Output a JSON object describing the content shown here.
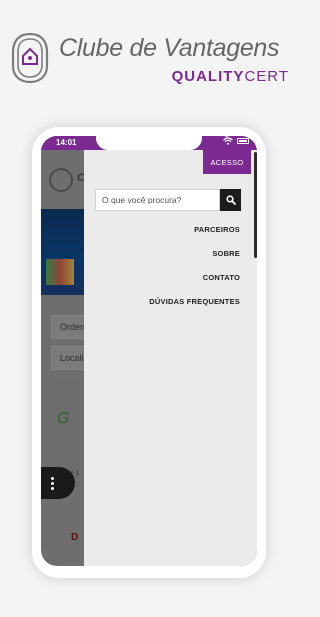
{
  "brand": {
    "title": "Clube de Vantagens",
    "subtitle_part1": "QUALITY",
    "subtitle_part2": "CERT"
  },
  "status_bar": {
    "time": "14:01",
    "icons": [
      "wifi-icon",
      "battery-icon"
    ]
  },
  "background_page": {
    "logo_text": "C",
    "order_field": "Orden",
    "location_field": "Locali",
    "small_text": "Até 1",
    "red_text": "D"
  },
  "drawer": {
    "acesso_label": "ACESSO",
    "search": {
      "placeholder": "O que você procura?",
      "icon": "search-icon"
    },
    "menu_items": [
      {
        "label": "PARCEIROS"
      },
      {
        "label": "SOBRE"
      },
      {
        "label": "CONTATO"
      },
      {
        "label": "DÚVIDAS FREQUENTES"
      }
    ]
  },
  "colors": {
    "brand_purple": "#7a2a91",
    "drawer_bg": "#ebebeb",
    "search_button": "#1c1c1c"
  }
}
